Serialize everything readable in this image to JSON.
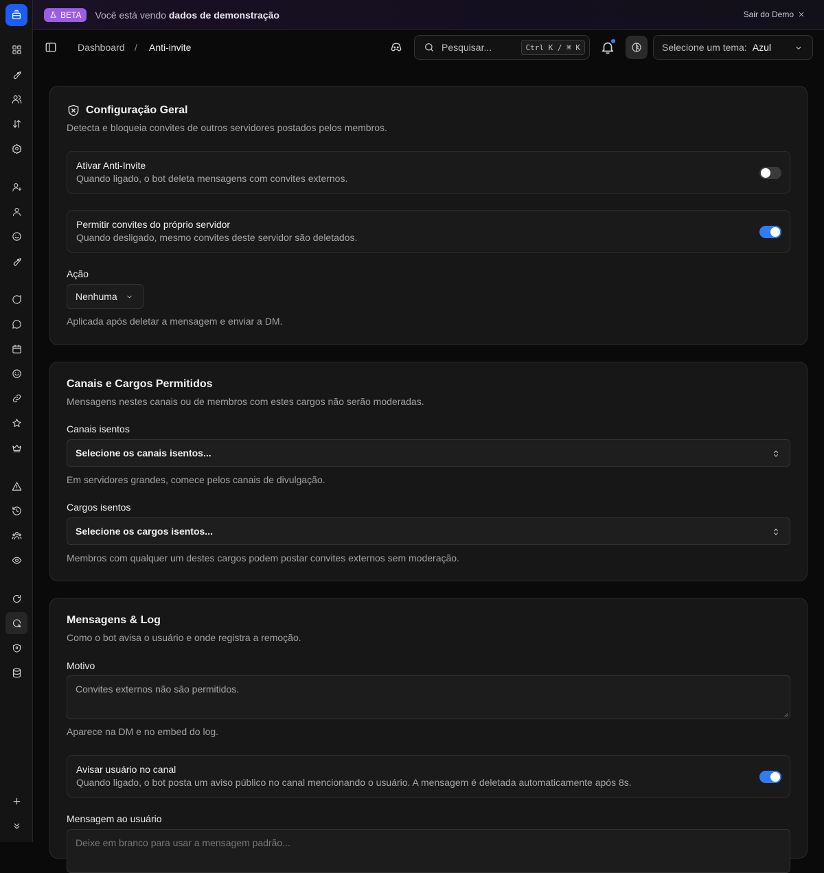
{
  "banner": {
    "badge": "BETA",
    "text_prefix": "Você está vendo ",
    "text_bold": "dados de demonstração",
    "exit_label": "Sair do Demo"
  },
  "topbar": {
    "breadcrumb": [
      "Dashboard",
      "/",
      "Anti-invite"
    ],
    "search_placeholder": "Pesquisar...",
    "search_shortcut": "Ctrl K / ⌘ K",
    "theme_label": "Selecione um tema:",
    "theme_value": "Azul"
  },
  "sidebar": {
    "icons": [
      "dashboard-icon",
      "rocket-icon",
      "users-icon",
      "sort-icon",
      "settings-icon",
      "user-plus-icon",
      "user-icon",
      "smile-icon",
      "rocket-icon",
      "message-icon",
      "message-icon",
      "calendar-icon",
      "smile-icon",
      "link-icon",
      "star-icon",
      "crown-icon",
      "warning-icon",
      "history-icon",
      "users-group-icon",
      "eye-icon",
      "refresh-message-icon",
      "message-search-icon",
      "shield-icon",
      "database-icon",
      "plus-icon",
      "chevrons-down-icon"
    ]
  },
  "general": {
    "title": "Configuração Geral",
    "description": "Detecta e bloqueia convites de outros servidores postados pelos membros.",
    "enable": {
      "title": "Ativar Anti-Invite",
      "description": "Quando ligado, o bot deleta mensagens com convites externos.",
      "on": false
    },
    "allow_own": {
      "title": "Permitir convites do próprio servidor",
      "description": "Quando desligado, mesmo convites deste servidor são deletados.",
      "on": true
    },
    "action_label": "Ação",
    "action_value": "Nenhuma",
    "action_hint": "Aplicada após deletar a mensagem e enviar a DM."
  },
  "allowed": {
    "title": "Canais e Cargos Permitidos",
    "description": "Mensagens nestes canais ou de membros com estes cargos não serão moderadas.",
    "channels_label": "Canais isentos",
    "channels_placeholder": "Selecione os canais isentos...",
    "channels_hint": "Em servidores grandes, comece pelos canais de divulgação.",
    "roles_label": "Cargos isentos",
    "roles_placeholder": "Selecione os cargos isentos...",
    "roles_hint": "Membros com qualquer um destes cargos podem postar convites externos sem moderação."
  },
  "messages": {
    "title": "Mensagens & Log",
    "description": "Como o bot avisa o usuário e onde registra a remoção.",
    "reason_label": "Motivo",
    "reason_value": "Convites externos não são permitidos.",
    "reason_hint": "Aparece na DM e no embed do log.",
    "warn": {
      "title": "Avisar usuário no canal",
      "description": "Quando ligado, o bot posta um aviso público no canal mencionando o usuário. A mensagem é deletada automaticamente após 8s.",
      "on": true
    },
    "user_msg_label": "Mensagem ao usuário",
    "user_msg_placeholder": "Deixe em branco para usar a mensagem padrão..."
  }
}
